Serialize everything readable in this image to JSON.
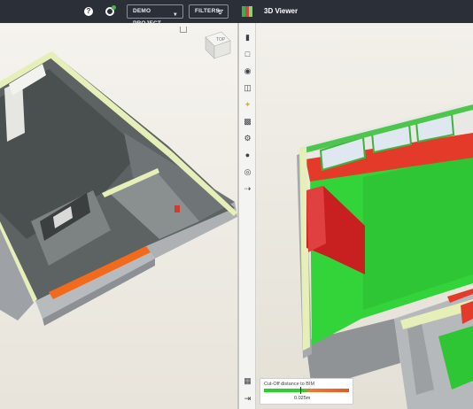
{
  "header": {
    "help_icon_text": "?",
    "project_button": "DEMO PROJECT",
    "filters_button": "FILTERS",
    "view_title": "3D Viewer"
  },
  "viewcube": {
    "label": "TOP"
  },
  "toolbar": {
    "items": [
      "chart-icon",
      "document-icon",
      "antenna-icon",
      "tag-icon",
      "scan-icon",
      "building-icon",
      "settings-icon",
      "person-icon",
      "globe-icon",
      "export-icon",
      "language-flag-icon",
      "collapse-icon"
    ]
  },
  "legend": {
    "title": "Cut-Off distance to BIM",
    "value": "0.025m"
  },
  "colors": {
    "topbar": "#2b3038",
    "deviation_green": "#2bd12b",
    "deviation_red": "#e02020",
    "brand_green": "#3fae49",
    "brand_red": "#d64545"
  }
}
